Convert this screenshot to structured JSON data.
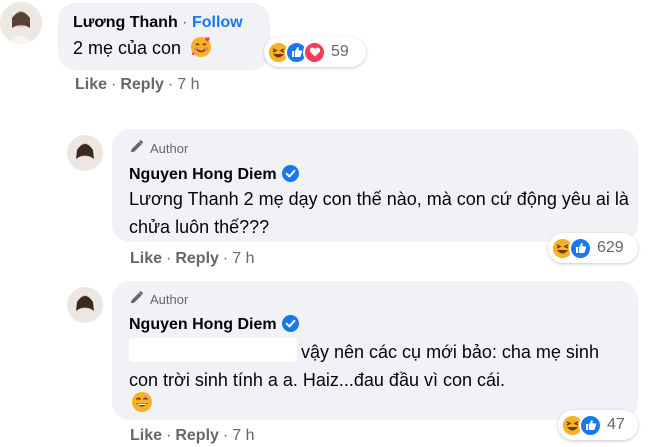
{
  "comments": [
    {
      "author": "Lương Thanh",
      "separator": "·",
      "follow_label": "Follow",
      "text": "2 mẹ của con",
      "emoji_icon": "smiling-face-with-hearts",
      "reaction_icons": [
        "haha",
        "like",
        "love"
      ],
      "reaction_count": "59",
      "like_label": "Like",
      "reply_label": "Reply",
      "time": "7 h"
    },
    {
      "badge_label": "Author",
      "author": "Nguyen Hong Diem",
      "mention": "Lương Thanh",
      "text": " 2 mẹ dạy con thế nào, mà con cứ động yêu ai là chửa luôn thế???",
      "reaction_icons": [
        "haha",
        "like"
      ],
      "reaction_count": "629",
      "like_label": "Like",
      "reply_label": "Reply",
      "time": "7 h"
    },
    {
      "badge_label": "Author",
      "author": "Nguyen Hong Diem",
      "text": "vậy nên các cụ mới bảo: cha mẹ sinh con trời sinh tính a a. Haiz...đau đầu vì con cái.",
      "emoji_icon": "grinning-face",
      "reaction_icons": [
        "haha",
        "like"
      ],
      "reaction_count": "47",
      "like_label": "Like",
      "reply_label": "Reply",
      "time": "7 h"
    }
  ],
  "colors": {
    "bubble": "#f0f2f5",
    "secondary_text": "#65676b",
    "link_blue": "#1877f2",
    "verified_blue": "#1877f2",
    "love_red": "#f33e58",
    "haha_yellow": "#f7b125"
  },
  "separator": "·"
}
